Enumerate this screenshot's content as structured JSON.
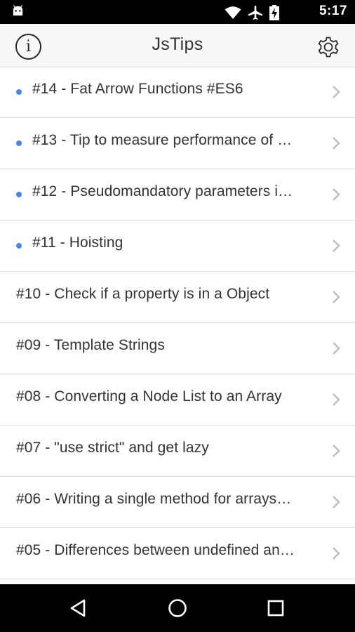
{
  "status_bar": {
    "time": "5:17",
    "icons": [
      "android-icon",
      "wifi-icon",
      "airplane-icon",
      "battery-charging-icon"
    ]
  },
  "header": {
    "title": "JsTips",
    "info_label": "i",
    "icons": [
      "info-icon",
      "gear-icon"
    ]
  },
  "tips": [
    {
      "title": "#14 - Fat Arrow Functions #ES6",
      "unread": true
    },
    {
      "title": "#13 - Tip to measure performance of …",
      "unread": true
    },
    {
      "title": "#12 - Pseudomandatory parameters i…",
      "unread": true
    },
    {
      "title": "#11 - Hoisting",
      "unread": true
    },
    {
      "title": "#10 - Check if a property is in a Object",
      "unread": false
    },
    {
      "title": "#09 - Template Strings",
      "unread": false
    },
    {
      "title": "#08 - Converting a Node List to an Array",
      "unread": false
    },
    {
      "title": "#07 - \"use strict\" and get lazy",
      "unread": false
    },
    {
      "title": "#06 - Writing a single method for arrays…",
      "unread": false
    },
    {
      "title": "#05 - Differences between undefined an…",
      "unread": false
    },
    {
      "title": "",
      "unread": false
    }
  ],
  "nav_bar": {
    "icons": [
      "back-icon",
      "home-icon",
      "recents-icon"
    ]
  },
  "colors": {
    "unread_dot": "#4a86e8",
    "header_bg": "#f7f7f7",
    "text": "#333333",
    "chevron": "#bdbdbd"
  }
}
